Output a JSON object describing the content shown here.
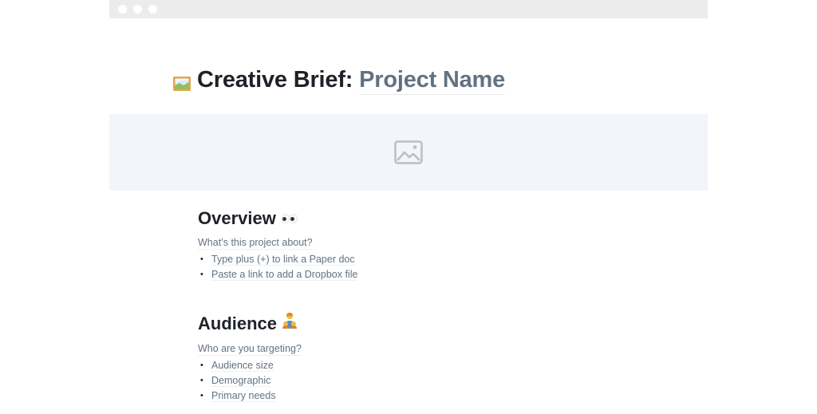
{
  "window": {
    "controls": [
      "close",
      "minimize",
      "maximize"
    ]
  },
  "document": {
    "title_emoji": "framed-picture-emoji",
    "title_prefix": "Creative Brief: ",
    "title_placeholder": "Project Name",
    "banner": {
      "icon": "image-placeholder-icon"
    },
    "sections": [
      {
        "heading": "Overview",
        "emoji": "eyes-emoji",
        "prompt": "What’s this project about?",
        "items": [
          "Type plus (+) to link a Paper doc",
          "Paste a link to add a Dropbox file"
        ]
      },
      {
        "heading": "Audience",
        "emoji": "family-emoji",
        "prompt": "Who are you targeting?",
        "items": [
          "Audience size",
          "Demographic",
          "Primary needs"
        ]
      }
    ]
  },
  "colors": {
    "heading": "#1e2228",
    "placeholder": "#637282",
    "banner_bg": "#f2f5fa",
    "titlebar_bg": "#ececec"
  }
}
